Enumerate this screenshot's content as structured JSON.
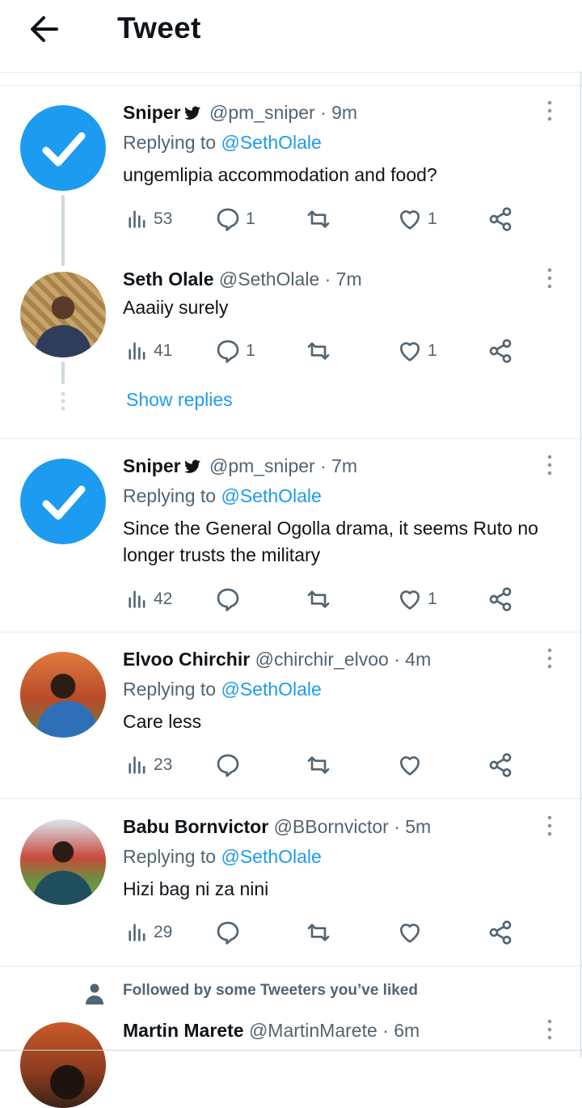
{
  "header": {
    "title": "Tweet"
  },
  "tweets": [
    {
      "name": "Sniper",
      "handle": "@pm_sniper",
      "time": "· 9m",
      "replying": "Replying to",
      "mention": "@SethOlale",
      "text": "ungemlipia accommodation and food?",
      "views": "53",
      "replies": "1",
      "retweets": "",
      "likes": "1"
    },
    {
      "name": "Seth Olale",
      "handle": "@SethOlale",
      "time": "· 7m",
      "text": "Aaaiiy surely",
      "views": "41",
      "replies": "1",
      "retweets": "",
      "likes": "1",
      "show_replies": "Show replies"
    },
    {
      "name": "Sniper",
      "handle": "@pm_sniper",
      "time": "· 7m",
      "replying": "Replying to",
      "mention": "@SethOlale",
      "text": "Since the General Ogolla drama, it seems Ruto no longer trusts the military",
      "views": "42",
      "replies": "",
      "retweets": "",
      "likes": "1"
    },
    {
      "name": "Elvoo Chirchir",
      "handle": "@chirchir_elvoo",
      "time": "· 4m",
      "replying": "Replying to",
      "mention": "@SethOlale",
      "text": "Care less",
      "views": "23",
      "replies": "",
      "retweets": "",
      "likes": ""
    },
    {
      "name": "Babu Bornvictor",
      "handle": "@BBornvictor",
      "time": "· 5m",
      "replying": "Replying to",
      "mention": "@SethOlale",
      "text": "Hizi bag ni za nini",
      "views": "29",
      "replies": "",
      "retweets": "",
      "likes": ""
    },
    {
      "name": "Martin Marete",
      "handle": "@MartinMarete",
      "time": "· 6m"
    }
  ],
  "followed_notice": "Followed by some Tweeters you’ve liked",
  "colors": {
    "accent": "#1d9bf0",
    "text": "#0f1419",
    "secondary": "#536471",
    "border": "#e6ecf0"
  }
}
